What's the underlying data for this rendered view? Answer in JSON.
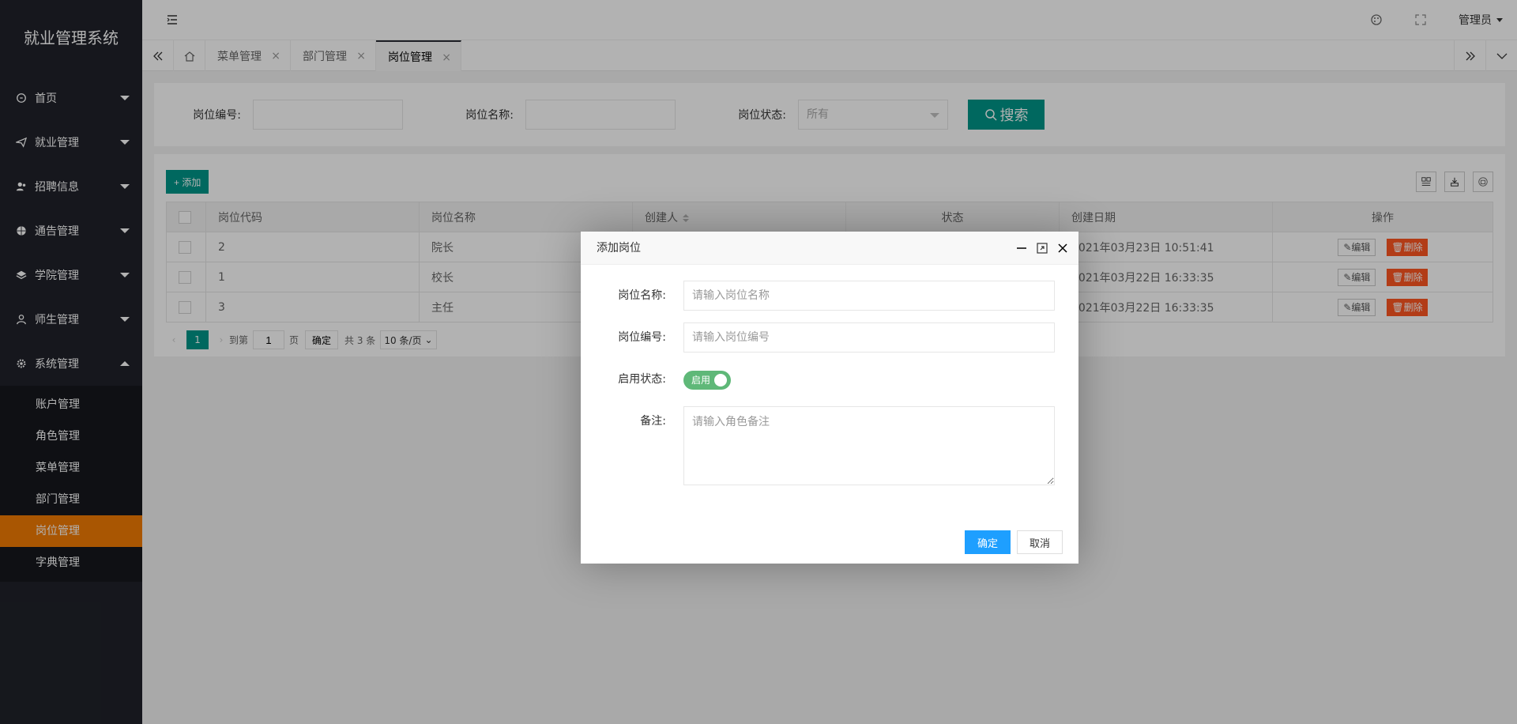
{
  "app": {
    "title": "就业管理系统"
  },
  "sidebar": {
    "items": [
      {
        "label": "首页",
        "icon": "home-icon"
      },
      {
        "label": "就业管理",
        "icon": "paper-plane-icon"
      },
      {
        "label": "招聘信息",
        "icon": "users-icon"
      },
      {
        "label": "通告管理",
        "icon": "globe-icon"
      },
      {
        "label": "学院管理",
        "icon": "layers-icon"
      },
      {
        "label": "师生管理",
        "icon": "user-icon"
      },
      {
        "label": "系统管理",
        "icon": "gear-icon",
        "expanded": true
      }
    ],
    "subitems": [
      {
        "label": "账户管理"
      },
      {
        "label": "角色管理"
      },
      {
        "label": "菜单管理"
      },
      {
        "label": "部门管理"
      },
      {
        "label": "岗位管理",
        "active": true
      },
      {
        "label": "字典管理"
      }
    ]
  },
  "header": {
    "user": "管理员"
  },
  "tabs": [
    {
      "label": "菜单管理"
    },
    {
      "label": "部门管理"
    },
    {
      "label": "岗位管理",
      "active": true
    }
  ],
  "search": {
    "code_label": "岗位编号:",
    "name_label": "岗位名称:",
    "status_label": "岗位状态:",
    "status_value": "所有",
    "button": "搜索"
  },
  "table": {
    "add_button": "+ 添加",
    "headers": [
      "岗位代码",
      "岗位名称",
      "创建人",
      "状态",
      "创建日期",
      "操作"
    ],
    "rows": [
      {
        "code": "2",
        "name": "院长",
        "creator": "",
        "status": "",
        "date": "2021年03月23日 10:51:41"
      },
      {
        "code": "1",
        "name": "校长",
        "creator": "",
        "status": "",
        "date": "2021年03月22日 16:33:35"
      },
      {
        "code": "3",
        "name": "主任",
        "creator": "",
        "status": "",
        "date": "2021年03月22日 16:33:35"
      }
    ],
    "edit_label": "编辑",
    "delete_label": "删除"
  },
  "pager": {
    "current": "1",
    "goto_label": "到第",
    "page_value": "1",
    "page_unit": "页",
    "confirm": "确定",
    "total": "共 3 条",
    "limit": "10 条/页"
  },
  "modal": {
    "title": "添加岗位",
    "name_label": "岗位名称:",
    "name_placeholder": "请输入岗位名称",
    "code_label": "岗位编号:",
    "code_placeholder": "请输入岗位编号",
    "enable_label": "启用状态:",
    "enable_text": "启用",
    "remark_label": "备注:",
    "remark_placeholder": "请输入角色备注",
    "ok": "确定",
    "cancel": "取消"
  }
}
